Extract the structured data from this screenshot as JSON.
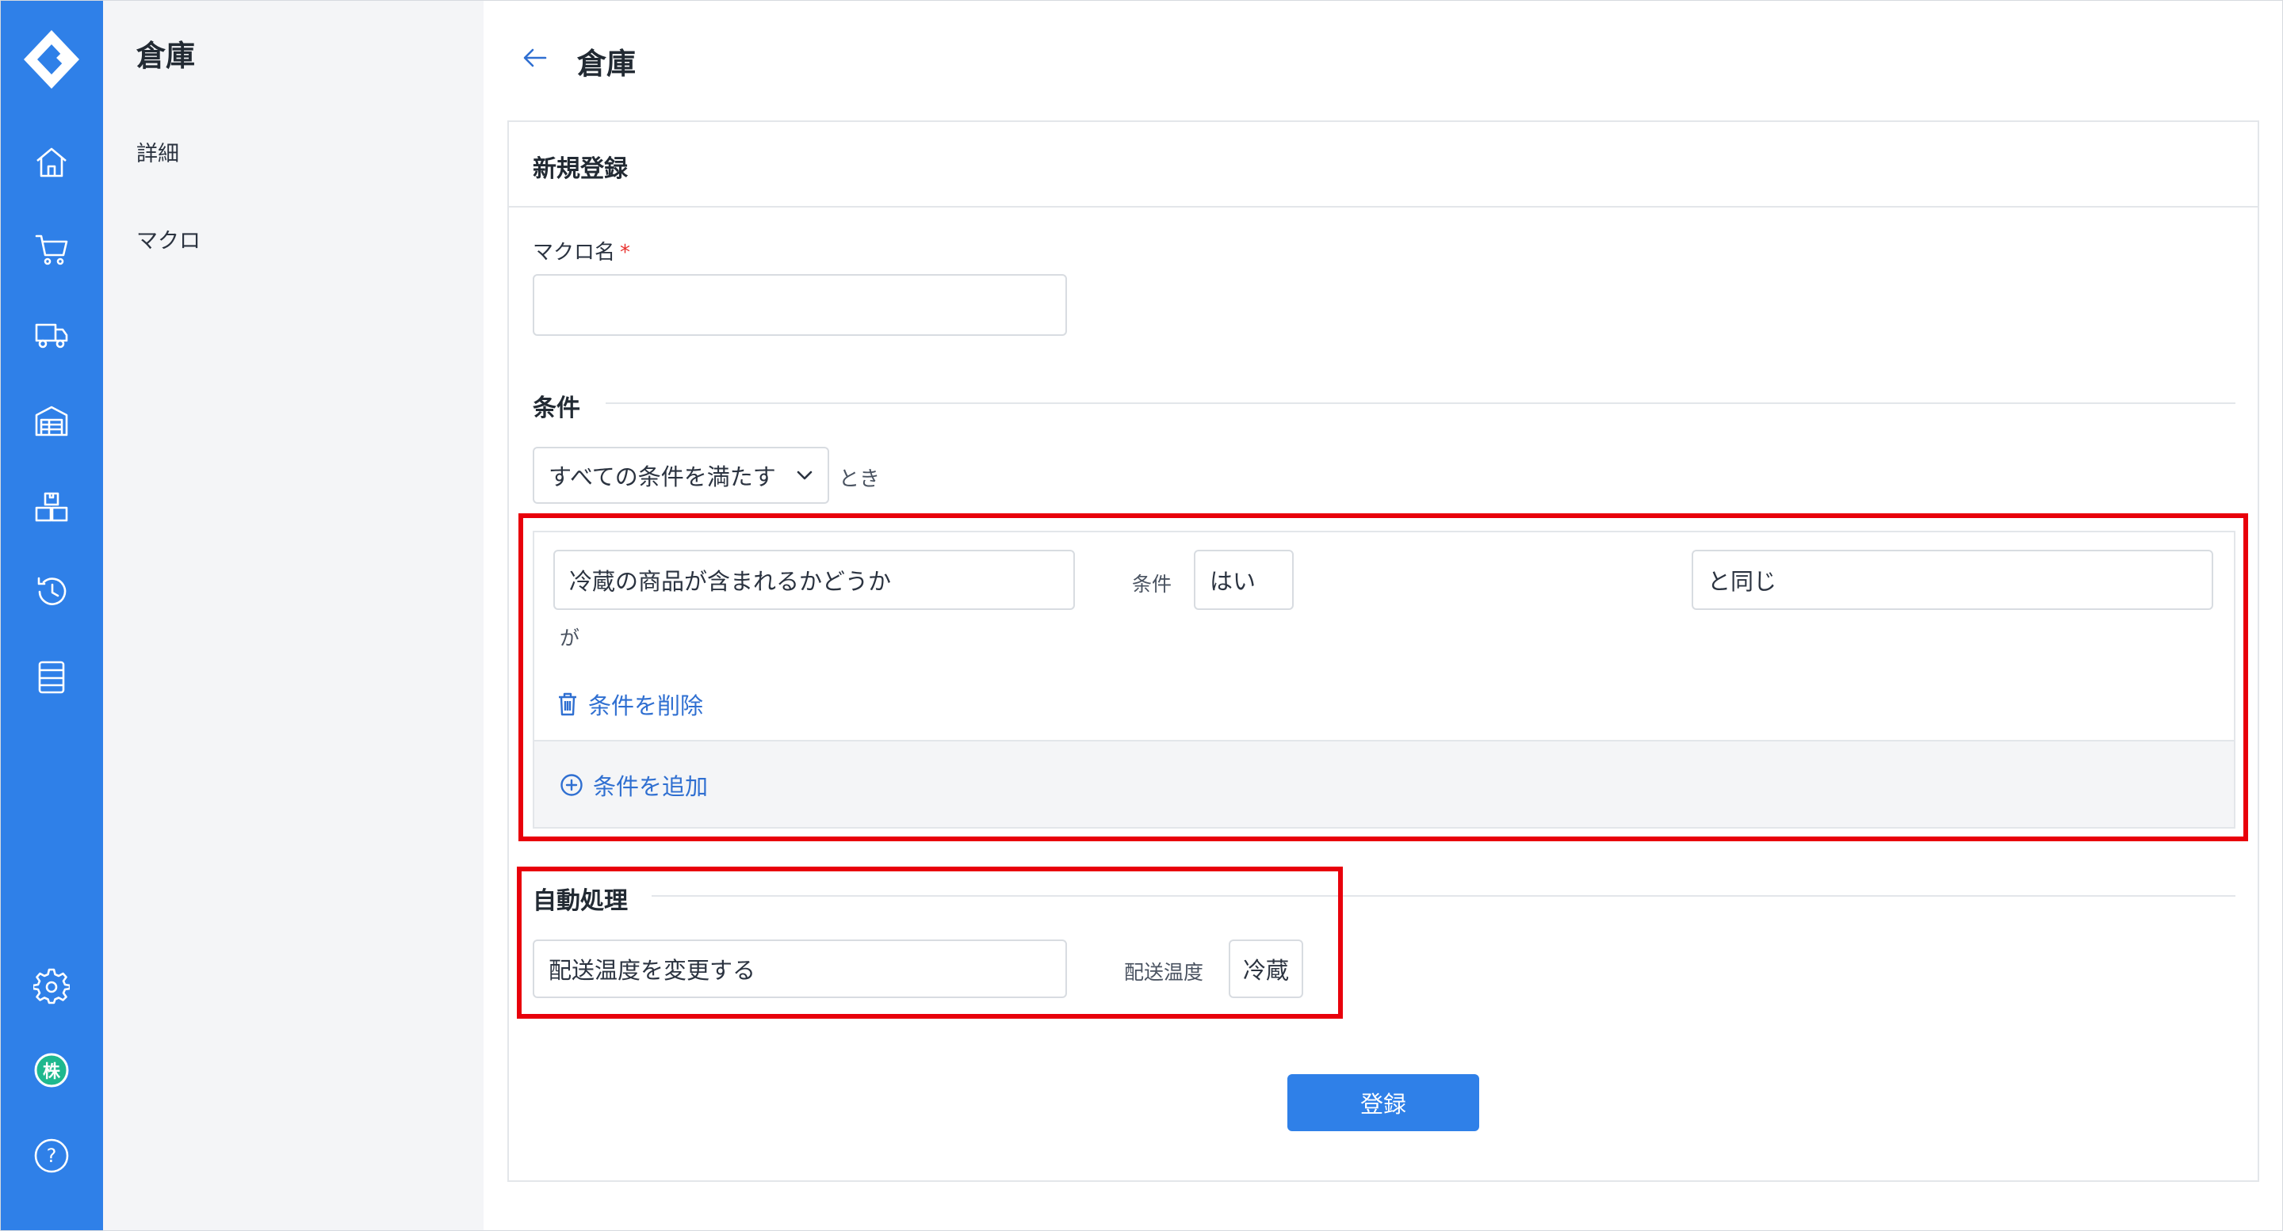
{
  "app": {
    "brand_color": "#2f80e8"
  },
  "rail": {
    "logo": "logo-icon",
    "icons": [
      "home-icon",
      "cart-icon",
      "truck-icon",
      "warehouse-icon",
      "boxes-icon",
      "history-icon",
      "list-icon",
      "gear-icon",
      "company-icon",
      "help-icon"
    ],
    "company_badge": "株",
    "help_glyph": "?"
  },
  "sidebar": {
    "title": "倉庫",
    "items": [
      {
        "label": "詳細"
      },
      {
        "label": "マクロ"
      }
    ]
  },
  "header": {
    "title": "倉庫"
  },
  "form": {
    "card_title": "新規登録",
    "macro_name": {
      "label": "マクロ名",
      "required_mark": "*",
      "value": ""
    },
    "conditions": {
      "section_title": "条件",
      "match_select": "すべての条件を満たす",
      "match_suffix": "とき",
      "rows": [
        {
          "field": "冷蔵の商品が含まれるかどうか",
          "field_suffix": "が",
          "operator_label": "条件",
          "value": "はい",
          "comparison": "と同じ"
        }
      ],
      "delete_label": "条件を削除",
      "add_label": "条件を追加"
    },
    "actions": {
      "section_title": "自動処理",
      "action": "配送温度を変更する",
      "param_label": "配送温度",
      "param_value": "冷蔵"
    },
    "submit_label": "登録"
  }
}
